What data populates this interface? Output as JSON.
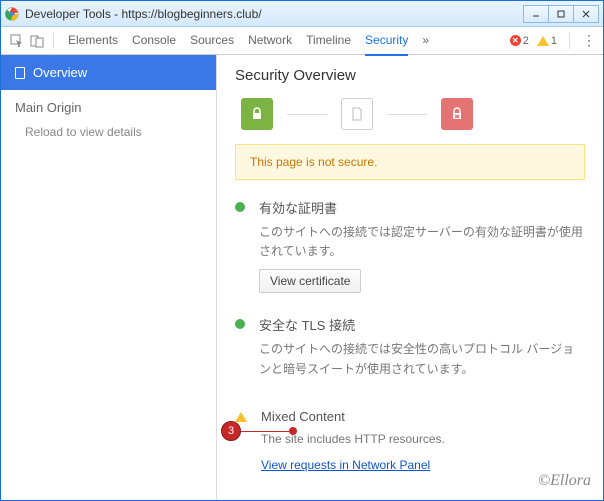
{
  "window": {
    "title": "Developer Tools - https://blogbeginners.club/"
  },
  "toolbar": {
    "tabs": [
      "Elements",
      "Console",
      "Sources",
      "Network",
      "Timeline",
      "Security"
    ],
    "active_tab": "Security",
    "overflow_glyph": "»",
    "error_count": "2",
    "warning_count": "1",
    "menu_glyph": "⋮"
  },
  "sidebar": {
    "overview_label": "Overview",
    "main_origin_label": "Main Origin",
    "reload_hint": "Reload to view details"
  },
  "main": {
    "heading": "Security Overview",
    "banner": "This page is not secure.",
    "items": [
      {
        "title": "有効な証明書",
        "desc": "このサイトへの接続では認定サーバーの有効な証明書が使用されています。",
        "button": "View certificate"
      },
      {
        "title": "安全な TLS 接続",
        "desc": "このサイトへの接続では安全性の高いプロトコル バージョンと暗号スイートが使用されています。"
      },
      {
        "title": "Mixed Content",
        "desc": "The site includes HTTP resources.",
        "link": "View requests in Network Panel"
      }
    ]
  },
  "annotation": {
    "badge": "3"
  },
  "watermark": "©Ellora"
}
